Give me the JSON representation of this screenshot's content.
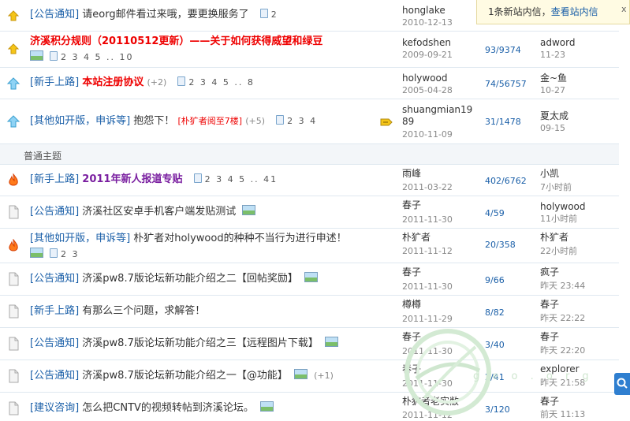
{
  "notification": {
    "message": "1条新站内信，",
    "link": "查看站内信",
    "close": "x"
  },
  "section_label": "普通主题",
  "rows": [
    {
      "icon": "announce-icon",
      "category": "[公告通知]",
      "title": "请eorg邮件看过来哦，要更换服务了",
      "title_style": "normal",
      "pages": "2",
      "author": "honglake",
      "adate": "2010-12-13",
      "count": "",
      "last": "",
      "ltime": ""
    },
    {
      "icon": "announce-icon",
      "category": "",
      "title": "济溪积分规则（20110512更新）——关于如何获得威望和绿豆",
      "title_style": "red",
      "pages": "2 3 4 5 .. 10",
      "author": "kefodshen",
      "adate": "2009-09-21",
      "count": "93/9374",
      "last": "adword",
      "ltime": "11-23"
    },
    {
      "icon": "pin-up-icon",
      "category": "[新手上路]",
      "title": "本站注册协议",
      "title_style": "red",
      "extra": "(+2)",
      "pages": "2 3 4 5 .. 8",
      "author": "holywood",
      "adate": "2005-04-28",
      "count": "74/56757",
      "last": "金~鱼",
      "ltime": "10-27"
    },
    {
      "icon": "pin-up-icon",
      "category": "[其他如开版，申诉等]",
      "title": "抱怨下！",
      "title_style": "normal",
      "mark": "[朴犷者阅至7楼]",
      "extra": "(+5)",
      "pages": "2 3 4",
      "author": "shuangmian1989",
      "adate": "2010-11-09",
      "count": "31/1478",
      "last": "夏太成",
      "ltime": "09-15"
    },
    {
      "icon": "hot-icon",
      "category": "[新手上路]",
      "title": "2011年新人报道专贴",
      "title_style": "purple",
      "pages": "2 3 4 5 .. 41",
      "author": "雨峰",
      "adate": "2011-03-22",
      "count": "402/6762",
      "last": "小凯",
      "ltime": "7小时前"
    },
    {
      "icon": "topic-icon",
      "category": "[公告通知]",
      "title": "济溪社区安卓手机客户端发贴测试",
      "title_style": "normal",
      "author": "春子",
      "adate": "2011-11-30",
      "count": "4/59",
      "last": "holywood",
      "ltime": "11小时前"
    },
    {
      "icon": "hot-icon",
      "category": "[其他如开版，申诉等]",
      "title": "朴犷者对holywood的种种不当行为进行申述！",
      "title_style": "normal",
      "pages": "2 3",
      "author": "朴犷者",
      "adate": "2011-11-12",
      "count": "20/358",
      "last": "朴犷者",
      "ltime": "22小时前"
    },
    {
      "icon": "topic-icon",
      "category": "[公告通知]",
      "title": "济溪pw8.7版论坛新功能介绍之二【回帖奖励】",
      "title_style": "normal",
      "author": "春子",
      "adate": "2011-11-30",
      "count": "9/66",
      "last": "疯子",
      "ltime": "昨天 23:44"
    },
    {
      "icon": "topic-icon",
      "category": "[新手上路]",
      "title": "有那么三个问题，求解答！",
      "title_style": "normal",
      "author": "樽樽",
      "adate": "2011-11-29",
      "count": "8/82",
      "last": "春子",
      "ltime": "昨天 22:22"
    },
    {
      "icon": "topic-icon",
      "category": "[公告通知]",
      "title": "济溪pw8.7版论坛新功能介绍之三【远程图片下载】",
      "title_style": "normal",
      "author": "春子",
      "adate": "2011-11-30",
      "count": "3/40",
      "last": "春子",
      "ltime": "昨天 22:20"
    },
    {
      "icon": "topic-icon",
      "category": "[公告通知]",
      "title": "济溪pw8.7版论坛新功能介绍之一【@功能】",
      "title_style": "normal",
      "extra": "(+1)",
      "author": "春子",
      "adate": "2011-11-30",
      "count": "2/41",
      "last": "explorer",
      "ltime": "昨天 21:58"
    },
    {
      "icon": "topic-icon",
      "category": "[建议咨询]",
      "title": "怎么把CNTV的视频转帖到济溪论坛。",
      "title_style": "normal",
      "author": "朴犷者老实敝",
      "adate": "2011-11-12",
      "count": "3/120",
      "last": "春子",
      "ltime": "前天 11:13"
    }
  ],
  "watermark_text": "g e o . o r g"
}
